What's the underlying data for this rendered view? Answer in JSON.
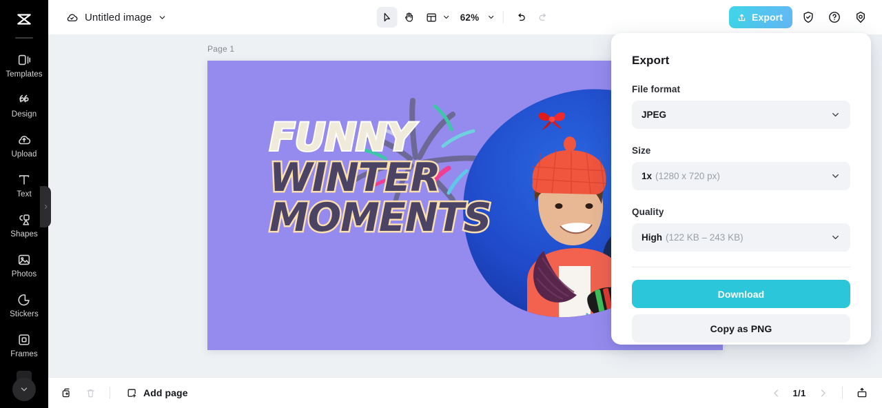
{
  "sidebar": {
    "logo": "capcut-logo",
    "items": [
      {
        "label": "Templates",
        "icon": "templates-icon"
      },
      {
        "label": "Design",
        "icon": "design-icon"
      },
      {
        "label": "Upload",
        "icon": "upload-cloud-icon"
      },
      {
        "label": "Text",
        "icon": "text-icon"
      },
      {
        "label": "Shapes",
        "icon": "shapes-icon"
      },
      {
        "label": "Photos",
        "icon": "photos-icon"
      },
      {
        "label": "Stickers",
        "icon": "stickers-icon"
      },
      {
        "label": "Frames",
        "icon": "frames-icon"
      }
    ],
    "collapse_icon": "chevron-right-icon",
    "more_icon": "chevron-down-icon"
  },
  "topbar": {
    "cloud_icon": "cloud-saved-icon",
    "doc_title": "Untitled image",
    "doc_chevron": "chevron-down-icon",
    "tools": [
      {
        "name": "select-tool",
        "icon": "cursor-icon",
        "active": true
      },
      {
        "name": "hand-tool",
        "icon": "hand-icon",
        "active": false
      },
      {
        "name": "layout-tool",
        "icon": "layout-icon",
        "active": false
      }
    ],
    "zoom_level": "62%",
    "undo_icon": "undo-icon",
    "redo_icon": "redo-icon",
    "export_label": "Export",
    "export_icon": "share-up-icon",
    "shield_icon": "shield-check-icon",
    "help_icon": "help-circle-icon",
    "settings_icon": "settings-gear-icon"
  },
  "canvas": {
    "page_label": "Page 1",
    "background_color": "#958bef",
    "art": {
      "line1": "FUNNY",
      "line2": "WINTER",
      "line3": "MOMENTS",
      "line1_color": "#efeada",
      "line1_stroke": "#ffffff",
      "line23_color": "#4b4363",
      "line23_stroke": "#fcdfae",
      "photo_alt": "two-children-winter-photo",
      "bow_sticker": "red-bow-sticker"
    }
  },
  "export_panel": {
    "title": "Export",
    "file_format": {
      "label": "File format",
      "value": "JPEG",
      "chevron": "chevron-down-icon"
    },
    "size": {
      "label": "Size",
      "value": "1x",
      "detail": "(1280 x 720 px)",
      "chevron": "chevron-down-icon"
    },
    "quality": {
      "label": "Quality",
      "value": "High",
      "detail": "(122 KB – 243 KB)",
      "chevron": "chevron-down-icon"
    },
    "download_label": "Download",
    "download_color": "#2cc6da",
    "copy_label": "Copy as PNG"
  },
  "bottombar": {
    "duplicate_icon": "duplicate-page-icon",
    "delete_icon": "trash-icon",
    "add_page_label": "Add page",
    "add_page_icon": "add-square-icon",
    "prev_icon": "chevron-left-icon",
    "page_indicator": "1/1",
    "next_icon": "chevron-right-icon",
    "present_icon": "present-icon"
  }
}
